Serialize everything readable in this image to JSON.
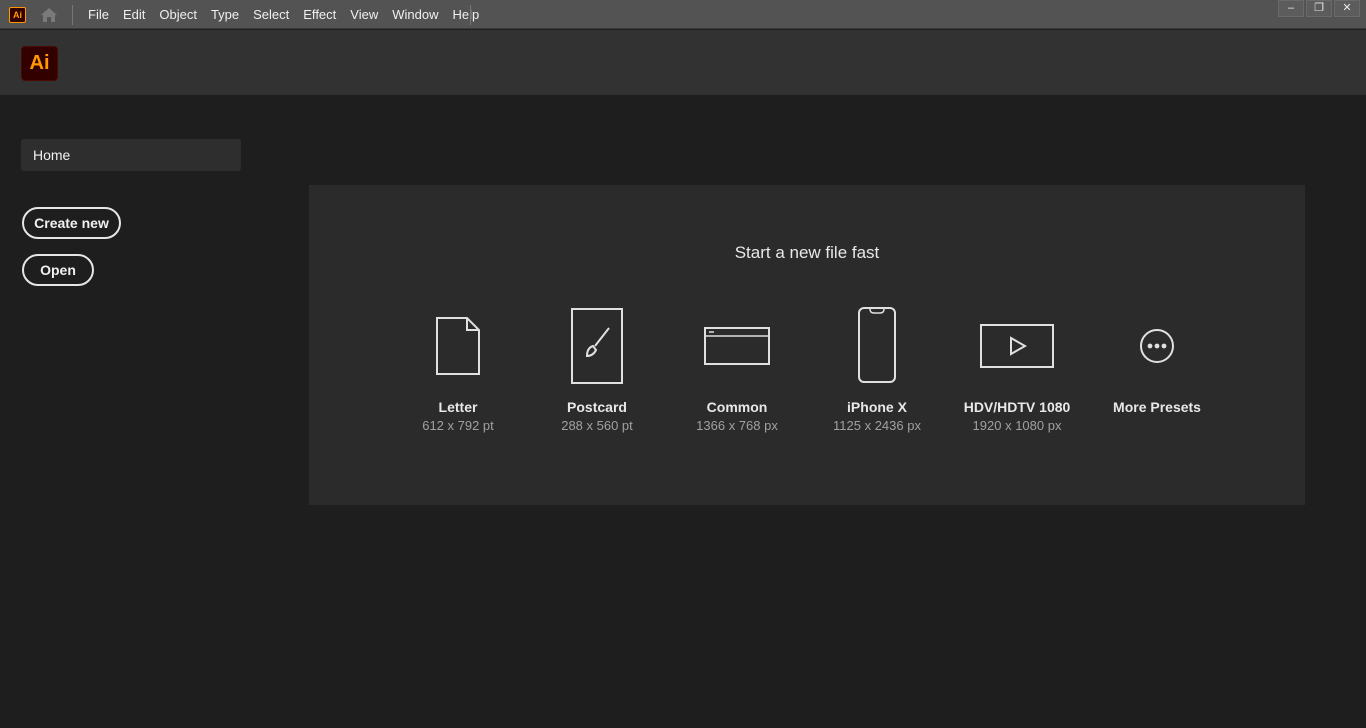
{
  "menubar": {
    "app_badge": "Ai",
    "home_icon": "home-icon",
    "items": [
      "File",
      "Edit",
      "Object",
      "Type",
      "Select",
      "Effect",
      "View",
      "Window",
      "Help"
    ],
    "window_controls": {
      "minimize": "–",
      "restore": "❐",
      "close": "✕"
    }
  },
  "header": {
    "logo": "Ai",
    "accent": "#ff9a00",
    "logo_bg": "#330000"
  },
  "sidebar": {
    "home": "Home",
    "create_new": "Create new",
    "open": "Open"
  },
  "main": {
    "title": "Start a new file fast",
    "presets": [
      {
        "name": "Letter",
        "size": "612 x 792 pt",
        "icon": "document-icon"
      },
      {
        "name": "Postcard",
        "size": "288 x 560 pt",
        "icon": "brush-card-icon"
      },
      {
        "name": "Common",
        "size": "1366 x 768 px",
        "icon": "browser-window-icon"
      },
      {
        "name": "iPhone X",
        "size": "1125 x 2436 px",
        "icon": "phone-icon"
      },
      {
        "name": "HDV/HDTV 1080",
        "size": "1920 x 1080 px",
        "icon": "video-play-icon"
      },
      {
        "name": "More Presets",
        "size": "",
        "icon": "more-ellipsis-icon"
      }
    ]
  }
}
